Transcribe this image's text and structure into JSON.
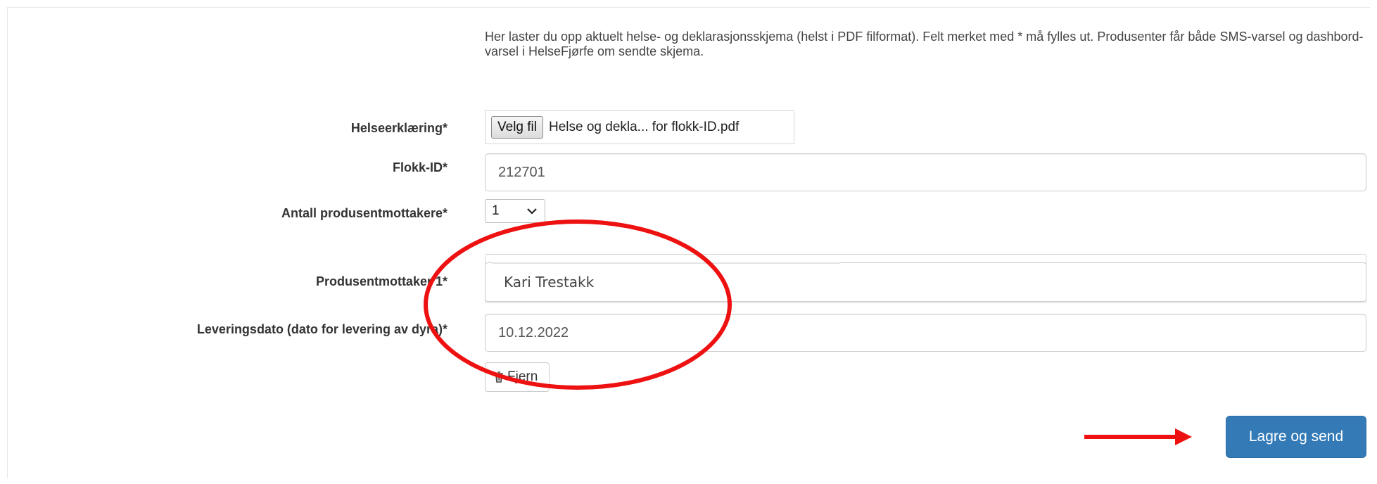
{
  "intro": {
    "text": "Her laster du opp aktuelt helse- og deklarasjonsskjema (helst i PDF filformat). Felt merket med * må fylles ut. Produsenter får både SMS-varsel og dashbord-varsel i HelseFjørfe om sendte skjema."
  },
  "form": {
    "health_label": "Helseerklæring*",
    "file_button_label": "Velg fil",
    "file_name": "Helse og dekla... for flokk-ID.pdf",
    "flock_label": "Flokk-ID*",
    "flock_value": "212701",
    "count_label": "Antall produsentmottakere*",
    "count_value": "1",
    "recipient_label": "Produsentmottaker 1*",
    "recipient_value": "Kari Trestakk",
    "delivery_label": "Leveringsdato (dato for levering av dyra)*",
    "delivery_value": "10.12.2022",
    "remove_label": "Fjern",
    "submit_label": "Lagre og send"
  },
  "colors": {
    "primary_button": "#337ab7",
    "annotation": "#ee1111"
  },
  "icons": {
    "file_picker": "file-button",
    "dropdown": "chevron-down-icon",
    "remove": "trash-icon"
  }
}
